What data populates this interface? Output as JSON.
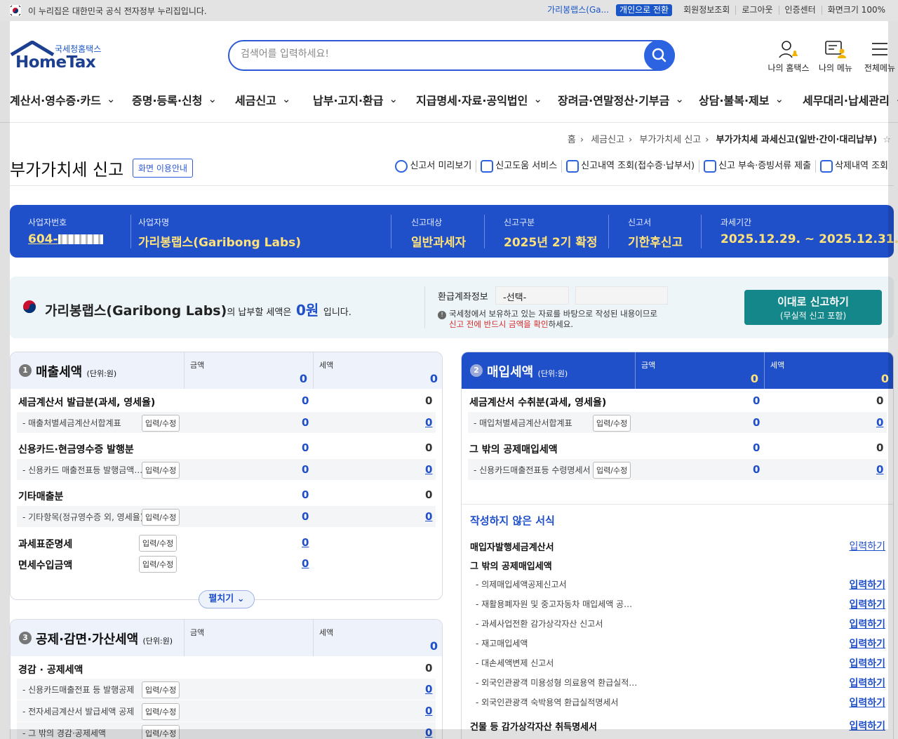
{
  "govbar": {
    "notice": "이 누리집은 대한민국 공식 전자정부 누리집입니다.",
    "user": "가리봉랩스(Ga...",
    "switch": "개인으로 전환",
    "links": [
      "회원정보조회",
      "로그아웃",
      "인증센터",
      "화면크기 100%"
    ]
  },
  "header": {
    "logo_sub": "국세청홈택스",
    "logo_main": "HomeTax",
    "search_placeholder": "검색어를 입력하세요!",
    "icons": [
      {
        "label": "나의 홈택스",
        "icon": "user-bell-icon"
      },
      {
        "label": "나의 메뉴",
        "icon": "menu-user-icon"
      },
      {
        "label": "전체메뉴",
        "icon": "hamburger-icon"
      }
    ]
  },
  "nav": [
    "계산서·영수증·카드",
    "증명·등록·신청",
    "세금신고",
    "납부·고지·환급",
    "지급명세·자료·공익법인",
    "장려금·연말정산·기부금",
    "상담·불복·제보",
    "세무대리·납세관리"
  ],
  "breadcrumb": [
    "홈",
    "세금신고",
    "부가가치세 신고",
    "부가가치세 과세신고(일반·간이·대리납부)"
  ],
  "page": {
    "title": "부가가치세 신고",
    "guide": "화면 이용안내",
    "tools": [
      "신고서 미리보기",
      "신고도움 서비스",
      "신고내역 조회(접수증·납부서)",
      "신고 부속·증빙서류 제출",
      "삭제내역 조회"
    ]
  },
  "info": {
    "bizno_label": "사업자번호",
    "bizno": "604-",
    "name_label": "사업자명",
    "name": "가리봉랩스(Garibong Labs)",
    "target_label": "신고대상",
    "target": "일반과세자",
    "type_label": "신고구분",
    "type": "2025년 2기 확정",
    "form_label": "신고서",
    "form": "기한후신고",
    "period_label": "과세기간",
    "period": "2025.12.29. ~ 2025.12.31."
  },
  "summary": {
    "name": "가리봉랩스(Garibong Labs)",
    "mid": "의 납부할 세액은",
    "amount": "0원",
    "end": "입니다.",
    "account_label": "환급계좌정보",
    "account_select": "-선택-",
    "note1": "국세청에서 보유하고 있는 자료를 바탕으로 작성된 내용이므로",
    "note2_warn": "신고 전에 반드시 금액을 확인",
    "note2_end": "하세요.",
    "submit1": "이대로 신고하기",
    "submit2": "(무실적 신고 포함)"
  },
  "sales": {
    "num": "1",
    "title": "매출세액",
    "unit": "(단위:원)",
    "amt_label": "금액",
    "tax_label": "세액",
    "amt_total": "0",
    "tax_total": "0",
    "rows": [
      {
        "label": "세금계산서 발급분(과세, 영세율)",
        "amt": "0",
        "tax": "0"
      },
      {
        "label": "- 매출처별세금계산서합계표",
        "edit": "입력/수정",
        "amt": "0",
        "tax": "0"
      },
      {
        "label": "신용카드·현금영수증 발행분",
        "amt": "0",
        "tax": "0"
      },
      {
        "label": "- 신용카드 매출전표등 발행금액…",
        "edit": "입력/수정",
        "amt": "0",
        "tax": "0"
      },
      {
        "label": "기타매출분",
        "amt": "0",
        "tax": "0"
      },
      {
        "label": "- 기타항목(정규영수증 외, 영세율)",
        "edit": "입력/수정",
        "amt": "0",
        "tax": "0"
      },
      {
        "label": "과세표준명세",
        "edit": "입력/수정",
        "amt": "0"
      },
      {
        "label": "면세수입금액",
        "edit": "입력/수정",
        "amt": "0"
      }
    ],
    "expand": "펼치기"
  },
  "purchase": {
    "num": "2",
    "title": "매입세액",
    "unit": "(단위:원)",
    "amt_label": "금액",
    "tax_label": "세액",
    "amt_total": "0",
    "tax_total": "0",
    "rows": [
      {
        "label": "세금계산서 수취분(과세, 영세율)",
        "amt": "0",
        "tax": "0"
      },
      {
        "label": "- 매입처별세금계산서합계표",
        "edit": "입력/수정",
        "amt": "0",
        "tax": "0"
      },
      {
        "label": "그 밖의 공제매입세액",
        "amt": "0",
        "tax": "0"
      },
      {
        "label": "- 신용카드매출전표등 수령명세서",
        "edit": "입력/수정",
        "amt": "0",
        "tax": "0"
      }
    ],
    "undone_title": "작성하지 않은 서식",
    "undone": [
      {
        "label": "매입자발행세금계산서",
        "go": "입력하기"
      },
      {
        "label": "그 밖의 공제매입세액"
      },
      {
        "label": "- 의제매입세액공제신고서",
        "go": "입력하기"
      },
      {
        "label": "- 재활용폐자원 및 중고자동차 매입세액 공…",
        "go": "입력하기"
      },
      {
        "label": "- 과세사업전환 감가상각자산 신고서",
        "go": "입력하기"
      },
      {
        "label": "- 재고매입세액",
        "go": "입력하기"
      },
      {
        "label": "- 대손세액변제 신고서",
        "go": "입력하기"
      },
      {
        "label": "- 외국인관광객 미용성형 의료용역 환급실적…",
        "go": "입력하기"
      },
      {
        "label": "- 외국인관광객 숙박용역 환급실적명세서",
        "go": "입력하기"
      },
      {
        "label": "건물 등 감가상각자산 취득명세서",
        "go": "입력하기"
      }
    ]
  },
  "deduct": {
    "num": "3",
    "title": "공제·감면·가산세액",
    "unit": "(단위:원)",
    "amt_label": "금액",
    "tax_label": "세액",
    "tax_total": "0",
    "rows": [
      {
        "label": "경감 · 공제세액",
        "tax": "0"
      },
      {
        "label": "- 신용카드매출전표 등 발행공제",
        "edit": "입력/수정",
        "tax": "0"
      },
      {
        "label": "- 전자세금계산서 발급세액 공제",
        "edit": "입력/수정",
        "tax": "0"
      },
      {
        "label": "- 그 밖의 경감·공제세액",
        "edit": "입력/수정",
        "tax": "0"
      }
    ]
  }
}
